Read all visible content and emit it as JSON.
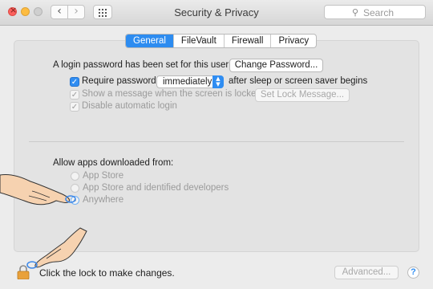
{
  "window": {
    "title": "Security & Privacy",
    "search_placeholder": "Search"
  },
  "nav": {
    "back": "‹",
    "forward": "›"
  },
  "tabs": [
    {
      "label": "General",
      "active": true
    },
    {
      "label": "FileVault",
      "active": false
    },
    {
      "label": "Firewall",
      "active": false
    },
    {
      "label": "Privacy",
      "active": false
    }
  ],
  "general": {
    "login_password_text": "A login password has been set for this user",
    "change_password_button": "Change Password...",
    "require_password": {
      "label": "Require password",
      "checked": true,
      "select_value": "immediately",
      "suffix": "after sleep or screen saver begins"
    },
    "show_message": {
      "label": "Show a message when the screen is locked",
      "checked": true,
      "enabled": false,
      "button": "Set Lock Message..."
    },
    "disable_auto_login": {
      "label": "Disable automatic login",
      "checked": true,
      "enabled": false
    }
  },
  "downloads": {
    "heading": "Allow apps downloaded from:",
    "options": [
      {
        "label": "App Store",
        "selected": false
      },
      {
        "label": "App Store and identified developers",
        "selected": false
      },
      {
        "label": "Anywhere",
        "selected": true
      }
    ]
  },
  "footer": {
    "lock_text": "Click the lock to make changes.",
    "advanced_button": "Advanced...",
    "help": "?"
  },
  "colors": {
    "accent": "#2d8cf0",
    "close": "#fc605c",
    "minimize": "#fdbc40",
    "lock": "#e9a13a"
  },
  "icons": [
    "close-icon",
    "minimize-icon",
    "zoom-icon",
    "grid-icon",
    "search-icon",
    "lock-icon",
    "help-icon",
    "pointing-hand-icon"
  ]
}
